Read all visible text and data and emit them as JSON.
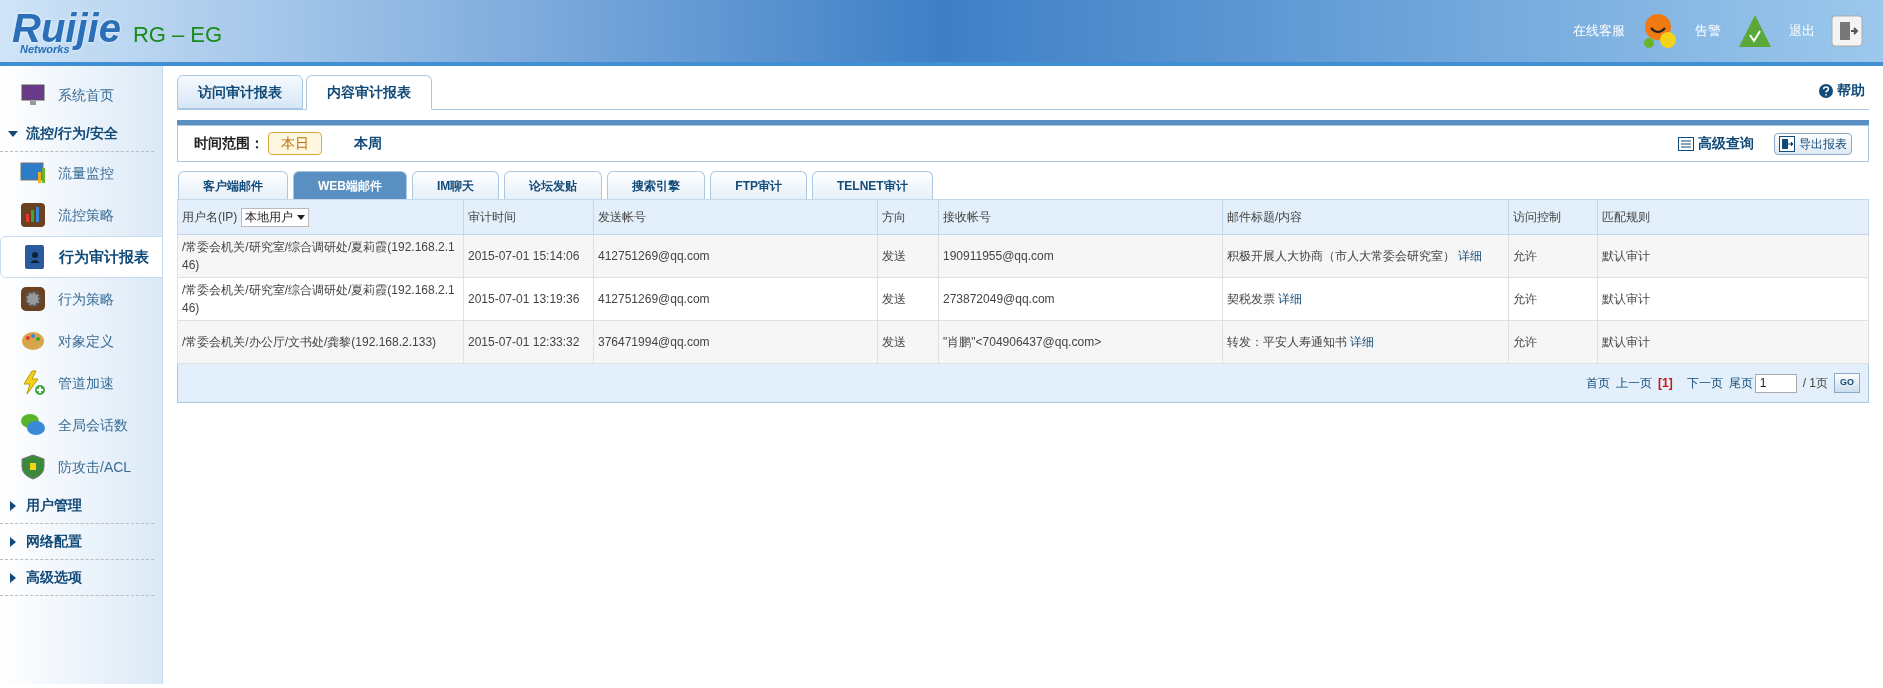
{
  "header": {
    "logo": "Ruijie",
    "logo_sub": "Networks",
    "product": "RG – EG",
    "links": [
      {
        "label": "在线客服",
        "kind": "support"
      },
      {
        "label": "告警",
        "kind": "alert"
      },
      {
        "label": "退出",
        "kind": "logout"
      }
    ]
  },
  "sidebar": {
    "items": [
      {
        "kind": "link",
        "label": "系统首页",
        "selected": false
      },
      {
        "kind": "section",
        "label": "流控/行为/安全",
        "expanded": true,
        "children": [
          {
            "label": "流量监控",
            "selected": false
          },
          {
            "label": "流控策略",
            "selected": false
          },
          {
            "label": "行为审计报表",
            "selected": true
          },
          {
            "label": "行为策略",
            "selected": false
          },
          {
            "label": "对象定义",
            "selected": false
          },
          {
            "label": "管道加速",
            "selected": false
          },
          {
            "label": "全局会话数",
            "selected": false
          },
          {
            "label": "防攻击/ACL",
            "selected": false
          }
        ]
      },
      {
        "kind": "section",
        "label": "用户管理",
        "expanded": false
      },
      {
        "kind": "section",
        "label": "网络配置",
        "expanded": false
      },
      {
        "kind": "section",
        "label": "高级选项",
        "expanded": false
      }
    ]
  },
  "main_tabs": [
    {
      "label": "访问审计报表",
      "selected": false
    },
    {
      "label": "内容审计报表",
      "selected": true
    }
  ],
  "help": "帮助",
  "time_range": {
    "label": "时间范围：",
    "options": [
      {
        "label": "本日",
        "selected": true
      },
      {
        "label": "本周",
        "selected": false
      }
    ]
  },
  "actions": [
    {
      "label": "高级查询",
      "kind": "query"
    },
    {
      "label": "导出报表",
      "kind": "export"
    }
  ],
  "sub_tabs": [
    {
      "label": "客户端邮件",
      "selected": false
    },
    {
      "label": "WEB端邮件",
      "selected": true
    },
    {
      "label": "IM聊天",
      "selected": false
    },
    {
      "label": "论坛发贴",
      "selected": false
    },
    {
      "label": "搜索引擎",
      "selected": false
    },
    {
      "label": "FTP审计",
      "selected": false
    },
    {
      "label": "TELNET审计",
      "selected": false
    }
  ],
  "table": {
    "columns": [
      "用户名(IP)",
      "审计时间",
      "发送帐号",
      "方向",
      "接收帐号",
      "邮件标题/内容",
      "访问控制",
      "匹配规则"
    ],
    "user_filter": "本地用户",
    "rows": [
      {
        "user": "/常委会机关/研究室/综合调研处/夏莉霞(192.168.2.146)",
        "time": "2015-07-01 15:14:06",
        "sender": "412751269@qq.com",
        "direction": "发送",
        "receiver": "190911955@qq.com",
        "subject": {
          "title": "积极开展人大协商（市人大常委会研究室）",
          "detail": "详细"
        },
        "access": "允许",
        "rule": "默认审计"
      },
      {
        "user": "/常委会机关/研究室/综合调研处/夏莉霞(192.168.2.146)",
        "time": "2015-07-01 13:19:36",
        "sender": "412751269@qq.com",
        "direction": "发送",
        "receiver": "273872049@qq.com",
        "subject": {
          "title": "契税发票",
          "detail": "详细"
        },
        "access": "允许",
        "rule": "默认审计"
      },
      {
        "user": "/常委会机关/办公厅/文书处/龚黎(192.168.2.133)",
        "time": "2015-07-01 12:33:32",
        "sender": "376471994@qq.com",
        "direction": "发送",
        "receiver": "\"肖鹏\"<704906437@qq.com>",
        "subject": {
          "title": "转发：平安人寿通知书",
          "detail": "详细"
        },
        "access": "允许",
        "rule": "默认审计"
      }
    ]
  },
  "pagination": {
    "first": "首页",
    "prev": "上一页",
    "current": "[1]",
    "next": "下一页",
    "last": "尾页",
    "page_value": "1",
    "total": "/ 1页",
    "go": "GO"
  }
}
